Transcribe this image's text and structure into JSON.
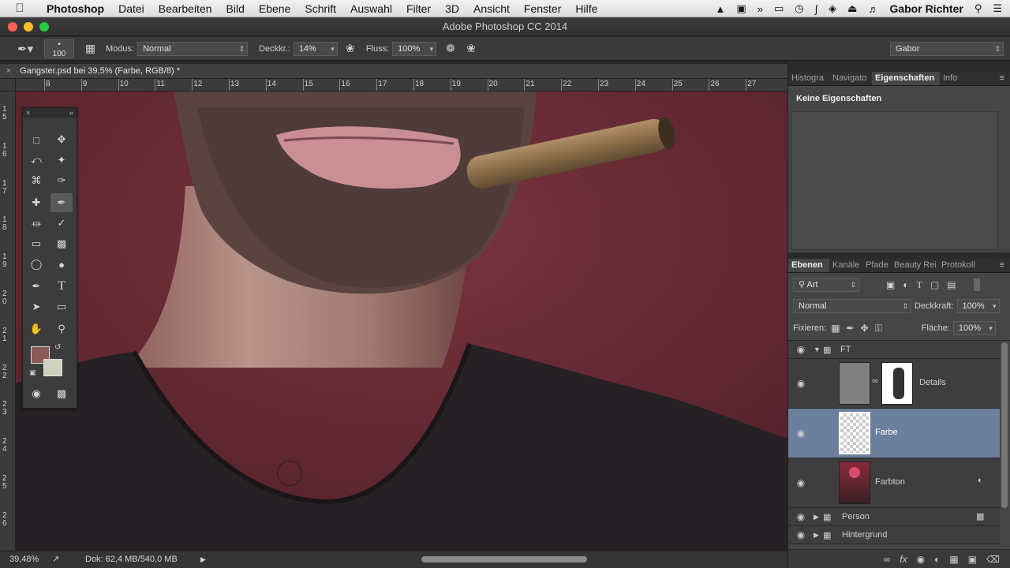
{
  "menubar": {
    "app": "Photoshop",
    "items": [
      "Datei",
      "Bearbeiten",
      "Bild",
      "Ebene",
      "Schrift",
      "Auswahl",
      "Filter",
      "3D",
      "Ansicht",
      "Fenster",
      "Hilfe"
    ],
    "user": "Gabor Richter"
  },
  "window": {
    "title": "Adobe Photoshop CC 2014"
  },
  "options": {
    "brush_size": "100",
    "mode_label": "Modus:",
    "mode_value": "Normal",
    "opacity_label": "Deckkr.:",
    "opacity_value": "14%",
    "flow_label": "Fluss:",
    "flow_value": "100%",
    "workspace": "Gabor"
  },
  "document": {
    "tab_title": "Gangster.psd bei 39,5% (Farbe, RGB/8) *"
  },
  "ruler": {
    "h_ticks": [
      "8",
      "9",
      "10",
      "11",
      "12",
      "13",
      "14",
      "15",
      "16",
      "17",
      "18",
      "19",
      "20",
      "21",
      "22",
      "23",
      "24",
      "25",
      "26",
      "27"
    ],
    "v_ticks": [
      "1\n5",
      "1\n6",
      "1\n7",
      "1\n8",
      "1\n9",
      "2\n0",
      "2\n1",
      "2\n2",
      "2\n3",
      "2\n4",
      "2\n5",
      "2\n6"
    ]
  },
  "status": {
    "zoom": "39,48%",
    "doc": "Dok: 62,4 MB/540,0 MB"
  },
  "properties_panel": {
    "tabs": [
      "Histogra",
      "Navigato",
      "Eigenschaften",
      "Info"
    ],
    "active_tab": "Eigenschaften",
    "content": "Keine Eigenschaften"
  },
  "layers_panel": {
    "tabs": [
      "Ebenen",
      "Kanäle",
      "Pfade",
      "Beauty Rei",
      "Protokoll"
    ],
    "active_tab": "Ebenen",
    "filter_kind": "Art",
    "blend_mode": "Normal",
    "opacity_label": "Deckkraft:",
    "opacity_value": "100%",
    "lock_label": "Fixieren:",
    "fill_label": "Fläche:",
    "fill_value": "100%",
    "layers": [
      {
        "name": "FT",
        "type": "group",
        "expanded": true,
        "selected": false
      },
      {
        "name": "Details",
        "type": "layer",
        "selected": false
      },
      {
        "name": "Farbe",
        "type": "layer",
        "selected": true
      },
      {
        "name": "Farbton",
        "type": "layer",
        "selected": false
      },
      {
        "name": "Person",
        "type": "group",
        "expanded": false,
        "selected": false
      },
      {
        "name": "Hintergrund",
        "type": "group",
        "expanded": false,
        "selected": false
      }
    ]
  },
  "colors": {
    "foreground": "#8a5a55",
    "background": "#cfd3bd",
    "selected_layer": "#6c7f9c"
  }
}
